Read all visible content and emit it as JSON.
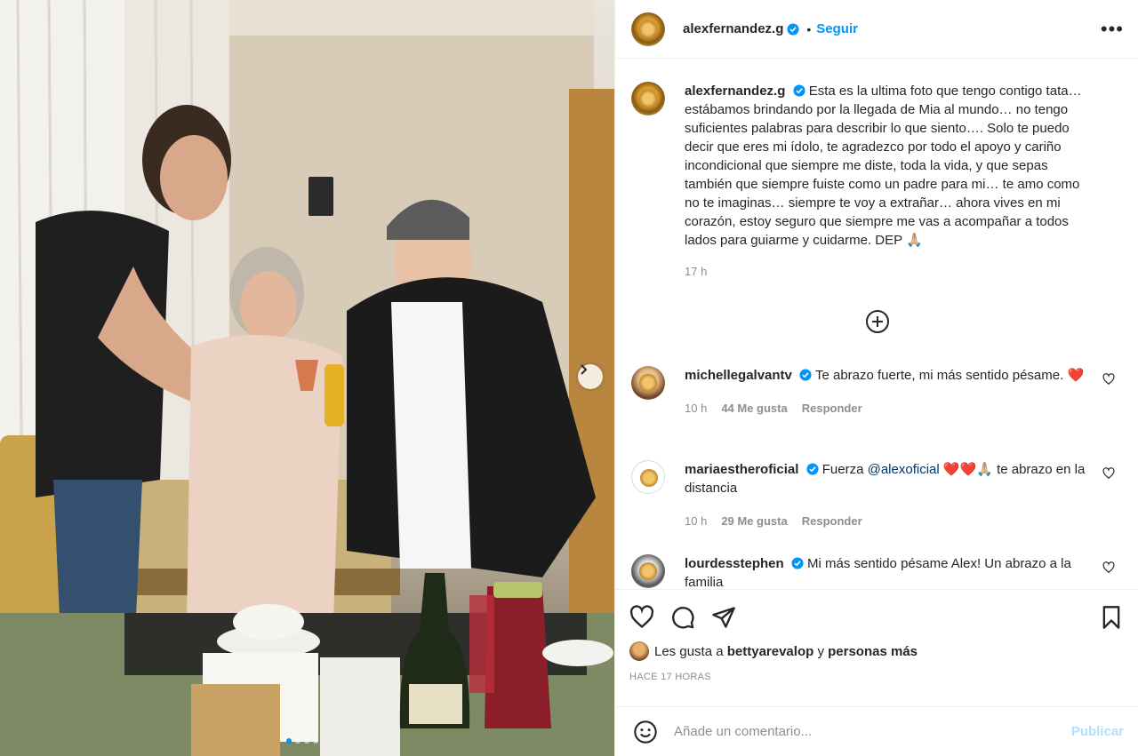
{
  "header": {
    "username": "alexfernandez.g",
    "separator": "•",
    "follow_label": "Seguir",
    "more_label": "•••"
  },
  "caption": {
    "username": "alexfernandez.g",
    "text": "Esta es la ultima foto que tengo contigo tata… estábamos brindando por la llegada de Mia al mundo… no tengo suficientes palabras para describir lo que siento…. Solo te puedo decir que eres mi ídolo, te agradezco por todo el apoyo y cariño incondicional que siempre me diste, toda la vida, y que sepas también que siempre fuiste como un padre para mi… te amo como no te imaginas… siempre te voy a extrañar… ahora vives en mi corazón, estoy seguro que siempre me vas a acompañar a todos lados para guiarme y cuidarme. DEP 🙏🏼",
    "time": "17 h"
  },
  "comments": [
    {
      "username": "michellegalvantv",
      "text": "Te abrazo fuerte, mi más sentido pésame. ❤️",
      "time": "10 h",
      "likes": "44 Me gusta",
      "reply": "Responder"
    },
    {
      "username": "mariaestheroficial",
      "text_before": "Fuerza ",
      "mention": "@alexoficial",
      "text_after": " ❤️❤️🙏🏼 te abrazo en la distancia",
      "time": "10 h",
      "likes": "29 Me gusta",
      "reply": "Responder"
    },
    {
      "username": "lourdesstephen",
      "text": "Mi más sentido pésame Alex! Un abrazo a la familia"
    }
  ],
  "likes": {
    "prefix": "Les gusta a ",
    "user": "bettyarevalop",
    "middle": " y ",
    "others": "personas más"
  },
  "post_time": "HACE 17 HORAS",
  "add_comment": {
    "placeholder": "Añade un comentario...",
    "publish_label": "Publicar"
  },
  "carousel": {
    "total": 4,
    "active_index": 0
  },
  "colors": {
    "accent": "#0095f6",
    "publish_disabled": "#b2dffc",
    "muted": "#8e8e8e"
  }
}
